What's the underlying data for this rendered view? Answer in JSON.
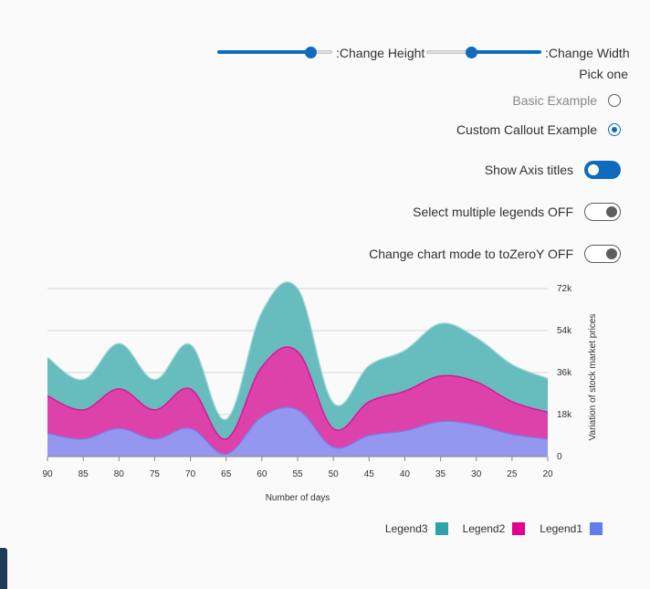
{
  "controls": {
    "height_label": ":Change Height",
    "width_label": ":Change Width",
    "height_value": 0.85,
    "width_value": 0.38,
    "accent_color": "#0f6cbd"
  },
  "pick_one": "Pick one",
  "radios": [
    {
      "label": "Basic Example",
      "checked": false
    },
    {
      "label": "Custom Callout Example",
      "checked": true
    }
  ],
  "toggles": [
    {
      "label": "Show Axis titles",
      "on": true
    },
    {
      "label": "Select multiple legends OFF",
      "on": false
    },
    {
      "label": "Change chart mode to toZeroY OFF",
      "on": false
    }
  ],
  "chart_data": {
    "type": "area",
    "stacked": true,
    "curve": "smooth",
    "x": [
      90,
      85,
      80,
      75,
      70,
      65,
      60,
      55,
      50,
      45,
      40,
      35,
      30,
      25,
      20
    ],
    "xlim": [
      90,
      20
    ],
    "xticks": [
      90,
      85,
      80,
      75,
      70,
      65,
      60,
      55,
      50,
      45,
      40,
      35,
      30,
      25,
      20
    ],
    "ylim": [
      0,
      72000
    ],
    "yticks": [
      0,
      18000,
      36000,
      54000,
      72000
    ],
    "ytick_labels": [
      "0",
      "18k",
      "36k",
      "54k",
      "72k"
    ],
    "yaxis_position": "right",
    "xlabel": "Number of days",
    "ylabel": "Variation of stock market prices",
    "grid": "horizontal",
    "legend_position": "bottom-right",
    "series": [
      {
        "name": "Legend1",
        "color": "#8e9cf3",
        "line_color": "#6f80ec",
        "values": [
          10000,
          7500,
          12000,
          7500,
          12000,
          1000,
          17000,
          20000,
          4000,
          9000,
          11000,
          15000,
          13500,
          9500,
          7500
        ]
      },
      {
        "name": "Legend2",
        "color": "#e43ba9",
        "line_color": "#e3008c",
        "values": [
          16000,
          12500,
          17000,
          12500,
          17000,
          6500,
          21500,
          25000,
          8000,
          14500,
          17000,
          19500,
          18500,
          14000,
          11500
        ]
      },
      {
        "name": "Legend3",
        "color": "#5fb8bb",
        "line_color": "#9fd8d6",
        "values": [
          16500,
          13000,
          19500,
          13000,
          19000,
          8500,
          23500,
          27000,
          11000,
          15500,
          17500,
          22500,
          19000,
          16000,
          14500
        ]
      }
    ]
  },
  "legend": [
    {
      "label": "Legend3",
      "color": "#2ea4a8"
    },
    {
      "label": "Legend2",
      "color": "#e3008c"
    },
    {
      "label": "Legend1",
      "color": "#637cef"
    }
  ]
}
